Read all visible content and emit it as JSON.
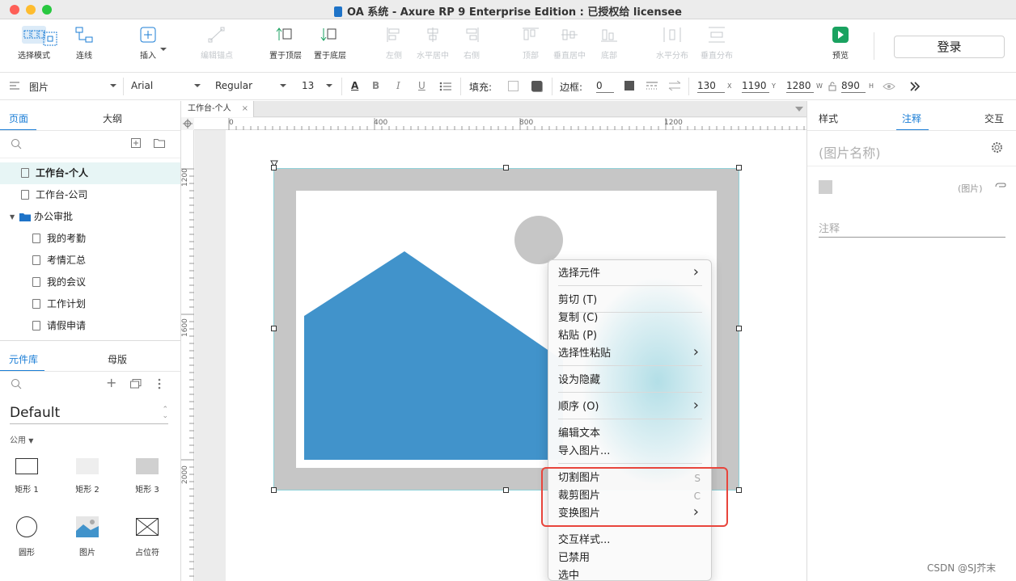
{
  "window": {
    "title": "OA 系统 - Axure RP 9 Enterprise Edition : 已授权给 licensee"
  },
  "toolbar": {
    "select_mode": "选择模式",
    "connect": "连线",
    "insert": "插入",
    "edit_anchor": "编辑锚点",
    "bring_front": "置于顶层",
    "send_back": "置于底层",
    "align_left": "左侧",
    "align_hcenter": "水平居中",
    "align_right": "右侧",
    "align_top": "顶部",
    "align_vcenter": "垂直居中",
    "align_bottom": "底部",
    "dist_h": "水平分布",
    "dist_v": "垂直分布",
    "preview": "预览",
    "login": "登录"
  },
  "format": {
    "widget_type": "图片",
    "font": "Arial",
    "weight": "Regular",
    "size": "13",
    "fill_label": "填充:",
    "border_label": "边框:",
    "border_value": "0",
    "x": "130",
    "x_label": "X",
    "y": "1190",
    "y_label": "Y",
    "w": "1280",
    "w_label": "W",
    "h": "890",
    "h_label": "H"
  },
  "left": {
    "tabs": [
      "页面",
      "大纲"
    ],
    "pages": [
      {
        "label": "工作台-个人",
        "level": 0,
        "selected": true,
        "type": "page"
      },
      {
        "label": "工作台-公司",
        "level": 0,
        "selected": false,
        "type": "page"
      },
      {
        "label": "办公审批",
        "level": 0,
        "selected": false,
        "type": "folder"
      },
      {
        "label": "我的考勤",
        "level": 1,
        "selected": false,
        "type": "page"
      },
      {
        "label": "考情汇总",
        "level": 1,
        "selected": false,
        "type": "page"
      },
      {
        "label": "我的会议",
        "level": 1,
        "selected": false,
        "type": "page"
      },
      {
        "label": "工作计划",
        "level": 1,
        "selected": false,
        "type": "page"
      },
      {
        "label": "请假申请",
        "level": 1,
        "selected": false,
        "type": "page"
      }
    ],
    "lib_tabs": [
      "元件库",
      "母版"
    ],
    "library": "Default",
    "category": "公用",
    "widgets": [
      "矩形 1",
      "矩形 2",
      "矩形 3",
      "圆形",
      "图片",
      "占位符"
    ]
  },
  "canvas": {
    "doc_tab": "工作台-个人",
    "ruler_h": [
      "0",
      "400",
      "800",
      "1200"
    ],
    "ruler_v": [
      "1200",
      "1600",
      "2000"
    ]
  },
  "context_menu": {
    "items": [
      {
        "label": "选择元件",
        "submenu": true
      },
      {
        "label": "剪切 (T)"
      },
      {
        "label": "复制 (C)"
      },
      {
        "label": "粘贴 (P)"
      },
      {
        "label": "选择性粘贴",
        "submenu": true
      },
      {
        "label": "设为隐藏"
      },
      {
        "label": "顺序 (O)",
        "submenu": true
      },
      {
        "label": "编辑文本"
      },
      {
        "label": "导入图片..."
      },
      {
        "label": "切割图片",
        "shortcut": "S"
      },
      {
        "label": "裁剪图片",
        "shortcut": "C"
      },
      {
        "label": "变换图片",
        "submenu": true
      },
      {
        "label": "交互样式..."
      },
      {
        "label": "已禁用"
      },
      {
        "label": "选中"
      }
    ]
  },
  "right": {
    "tabs": [
      "样式",
      "注释",
      "交互"
    ],
    "widget_name_placeholder": "(图片名称)",
    "widget_type_label": "(图片)",
    "note_placeholder": "注释"
  },
  "watermark": "CSDN @SJ芥末",
  "colors": {
    "accent": "#1b7ed6",
    "image_blue": "#4193cb",
    "highlight": "#e8453c"
  }
}
